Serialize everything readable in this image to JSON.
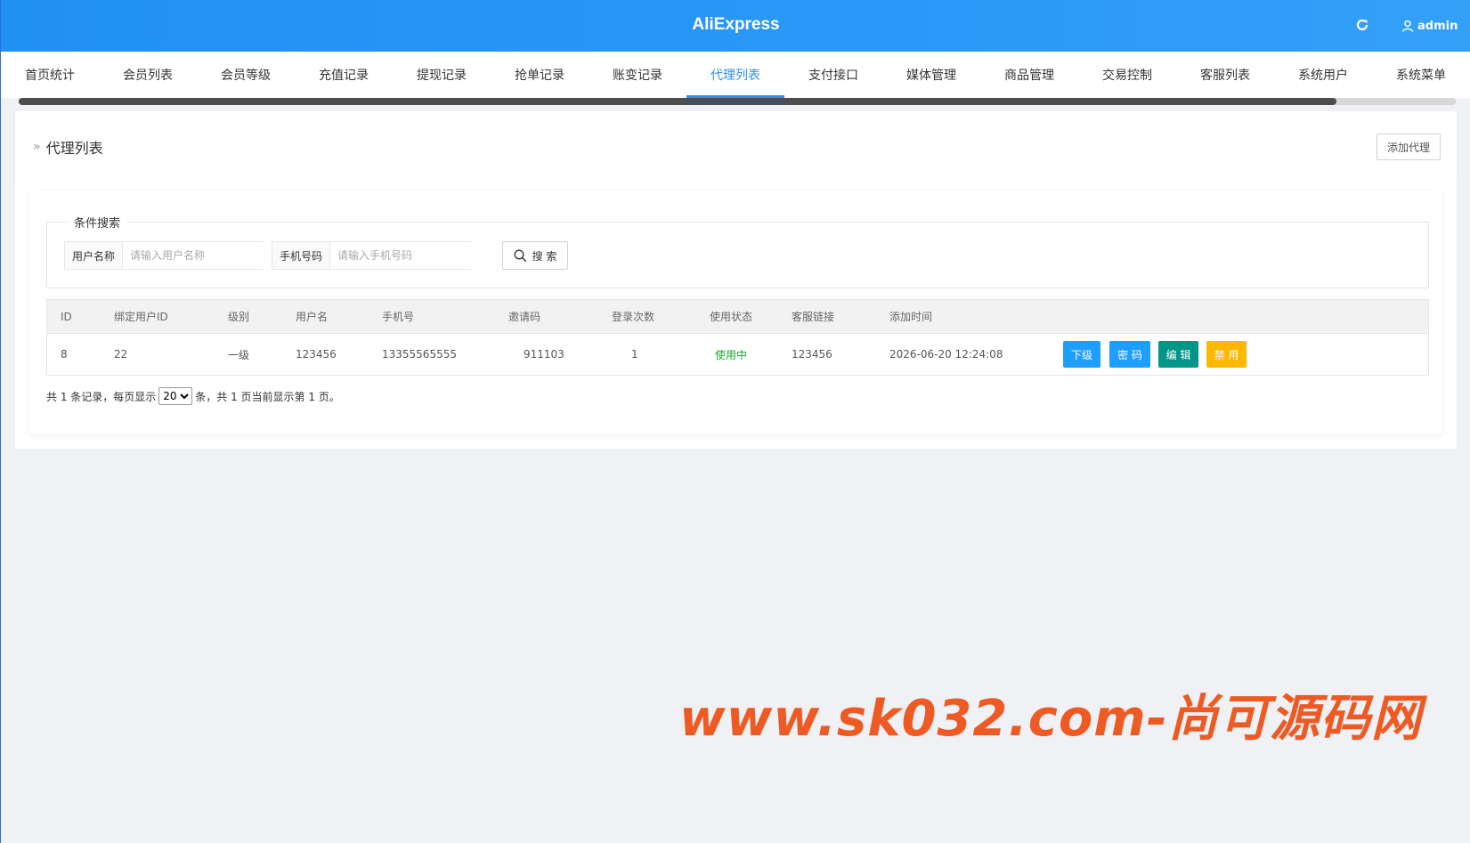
{
  "header": {
    "app_title": "AliExpress",
    "user_name": "admin"
  },
  "nav": {
    "tabs": [
      "首页统计",
      "会员列表",
      "会员等级",
      "充值记录",
      "提现记录",
      "抢单记录",
      "账变记录",
      "代理列表",
      "支付接口",
      "媒体管理",
      "商品管理",
      "交易控制",
      "客服列表",
      "系统用户",
      "系统菜单"
    ],
    "active_tab": "代理列表"
  },
  "page": {
    "breadcrumb_separator": "»",
    "title": "代理列表",
    "add_button": "添加代理"
  },
  "search": {
    "legend": "条件搜索",
    "username_label": "用户名称",
    "username_placeholder": "请输入用户名称",
    "phone_label": "手机号码",
    "phone_placeholder": "请输入手机号码",
    "search_button": "搜 索"
  },
  "table": {
    "headers": [
      "ID",
      "绑定用户ID",
      "级别",
      "用户名",
      "手机号",
      "邀请码",
      "登录次数",
      "使用状态",
      "客服链接",
      "添加时间"
    ],
    "rows": [
      {
        "id": "8",
        "bind_user_id": "22",
        "level": "一级",
        "username": "123456",
        "phone": "13355565555",
        "invite_code": "911103",
        "login_count": "1",
        "status": "使用中",
        "service_link": "123456",
        "created_at": "2026-06-20 12:24:08",
        "actions": [
          "下级",
          "密 码",
          "编 辑",
          "禁 用"
        ]
      }
    ]
  },
  "pager": {
    "prefix": "共 1 条记录，每页显示",
    "page_size": "20",
    "page_size_options": [
      "20"
    ],
    "suffix": "条，共 1 页当前显示第 1 页。"
  },
  "watermark": "www.sk032.com-尚可源码网",
  "colors": {
    "header": "#2190f3",
    "active_tab": "#2e8ded",
    "btn_blue": "#1e9fff",
    "btn_green": "#009688",
    "btn_yellow": "#ffb800",
    "status_ok": "#16a82a",
    "watermark": "#ee5a24"
  }
}
